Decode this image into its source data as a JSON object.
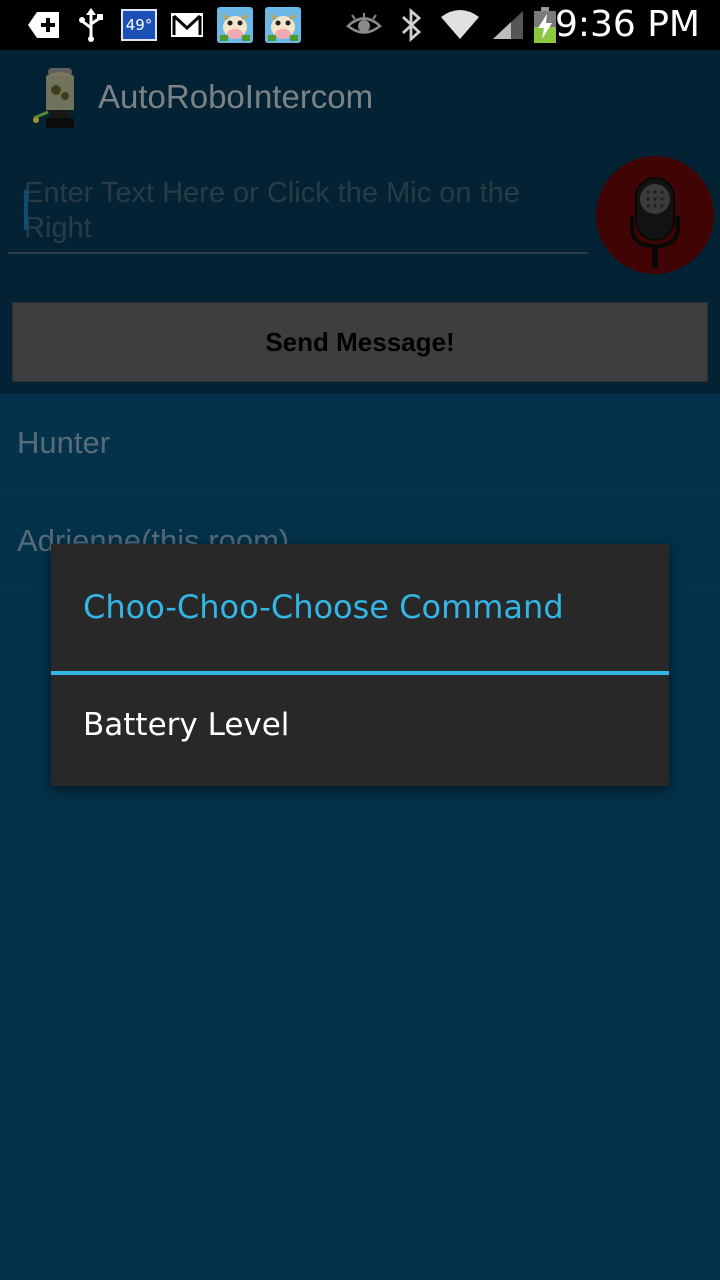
{
  "status_bar": {
    "time": "9:36 PM",
    "temperature": "49°",
    "left_icons": [
      "add-app-icon",
      "usb-icon",
      "temperature-badge",
      "gmail-icon",
      "cow-game-icon",
      "cow-game-icon"
    ],
    "right_icons": [
      "eye-icon",
      "bluetooth-icon",
      "wifi-icon",
      "signal-icon",
      "battery-charging-icon"
    ]
  },
  "app": {
    "title": "AutoRoboIntercom",
    "message_input": {
      "value": "",
      "placeholder": "Enter Text Here or Click the Mic on the Right"
    },
    "mic_button_icon": "microphone-icon",
    "send_button_label": "Send Message!",
    "rooms": [
      {
        "label": "Hunter"
      },
      {
        "label": "Adrienne(this room)"
      }
    ]
  },
  "dialog": {
    "title": "Choo-Choo-Choose Command",
    "items": [
      {
        "label": "Battery Level"
      }
    ]
  },
  "colors": {
    "accent": "#33b5e5",
    "background": "#05486a",
    "dialog_background": "#282828",
    "mic_background": "#5e0607"
  }
}
